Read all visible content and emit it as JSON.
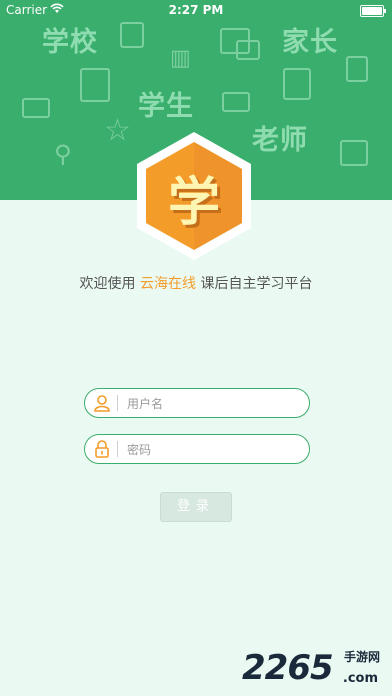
{
  "status_bar": {
    "carrier": "Carrier",
    "time": "2:27 PM"
  },
  "header": {
    "deco_words": [
      "学校",
      "家长",
      "学生",
      "老师"
    ],
    "deco_icons": [
      "news-icon",
      "chat-icon",
      "chart-icon",
      "mail-icon",
      "star-icon",
      "edit-icon",
      "certificate-icon",
      "tag-icon",
      "search-icon",
      "document-icon"
    ],
    "background_color": "#3aae6c"
  },
  "logo": {
    "char": "学",
    "color": "#f39c2a"
  },
  "welcome": {
    "prefix": "欢迎使用",
    "brand": "云海在线",
    "suffix": "课后自主学习平台"
  },
  "form": {
    "username_placeholder": "用户名",
    "password_placeholder": "密码",
    "login_label": "登录"
  },
  "watermark": {
    "number": "2265",
    "suffix": ".com",
    "cn": "手游网"
  }
}
